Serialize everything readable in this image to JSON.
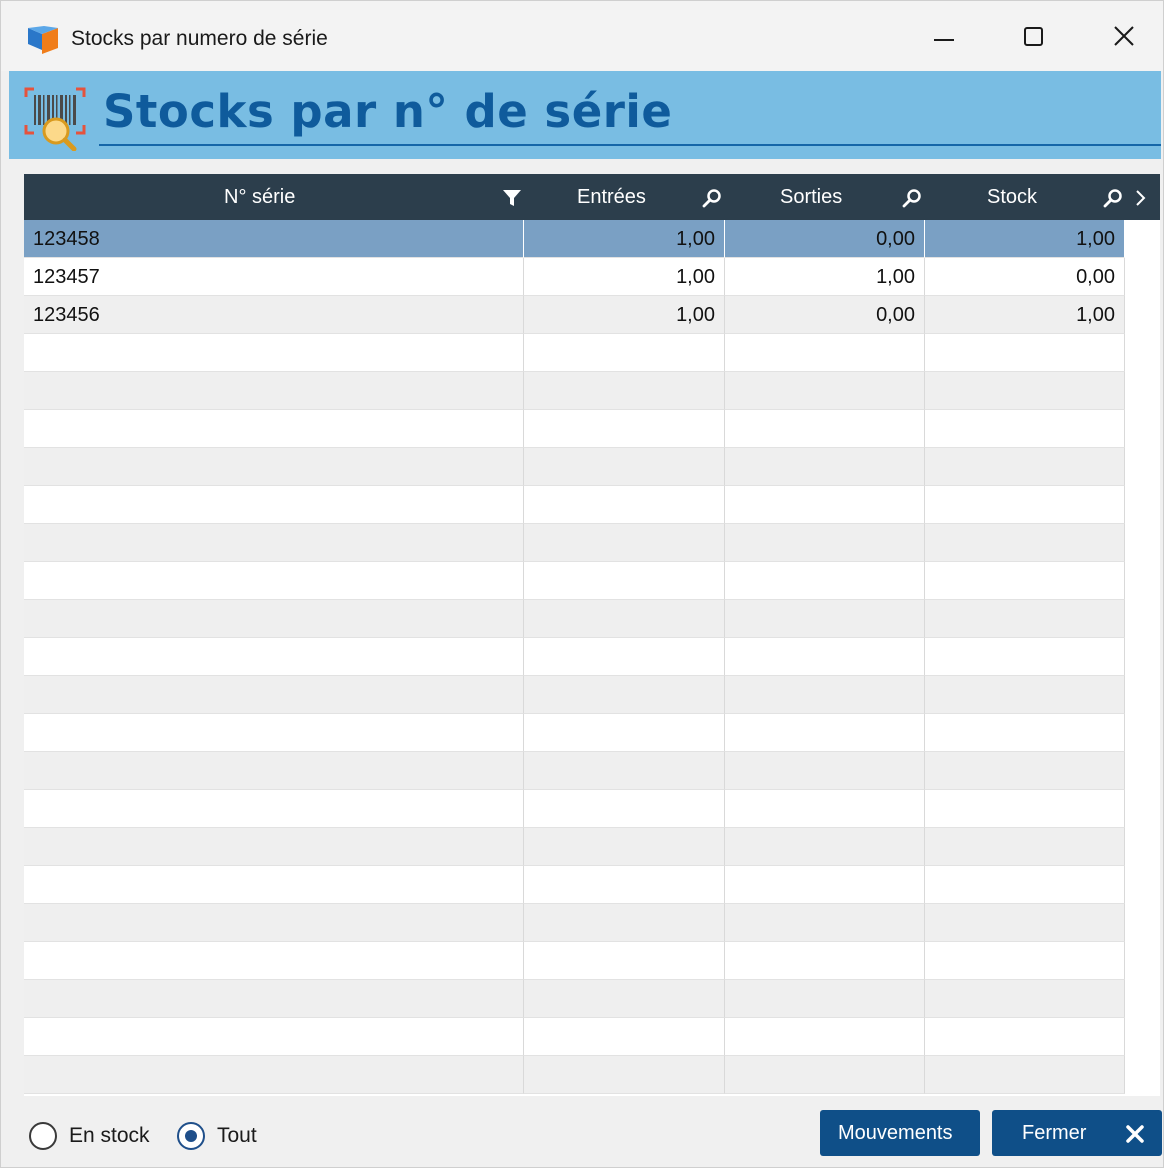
{
  "window": {
    "title": "Stocks par numero de série",
    "controls": [
      "minimize-icon",
      "maximize-icon",
      "close-icon"
    ]
  },
  "header": {
    "title": "Stocks par n° de série",
    "icon": "barcode-search-icon"
  },
  "colors": {
    "header_band": "#79bde3",
    "header_text": "#0f5b9c",
    "grid_header": "#2c3e4c",
    "selected_row": "#7aa0c4",
    "button": "#0f4f88"
  },
  "grid": {
    "columns": [
      {
        "label": "N° série",
        "icon": "filter-icon"
      },
      {
        "label": "Entrées",
        "icon": "search-icon"
      },
      {
        "label": "Sorties",
        "icon": "search-icon"
      },
      {
        "label": "Stock",
        "icon": "search-icon"
      }
    ],
    "rows": [
      {
        "serial": "123458",
        "entrees": "1,00",
        "sorties": "0,00",
        "stock": "1,00",
        "selected": true
      },
      {
        "serial": "123457",
        "entrees": "1,00",
        "sorties": "1,00",
        "stock": "0,00",
        "selected": false
      },
      {
        "serial": "123456",
        "entrees": "1,00",
        "sorties": "0,00",
        "stock": "1,00",
        "selected": false
      }
    ]
  },
  "footer": {
    "radios": [
      {
        "label": "En stock",
        "checked": false
      },
      {
        "label": "Tout",
        "checked": true
      }
    ],
    "mouvements_label": "Mouvements",
    "fermer_label": "Fermer"
  }
}
